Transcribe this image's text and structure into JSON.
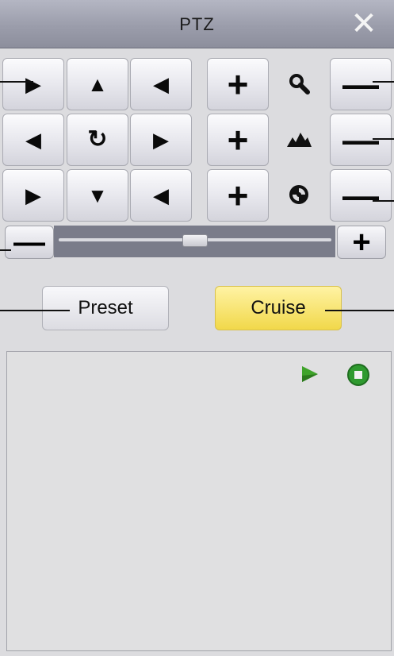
{
  "window": {
    "title": "PTZ",
    "close_symbol": "✕"
  },
  "direction_pad": [
    {
      "name": "up-left",
      "symbol": "▶"
    },
    {
      "name": "up",
      "symbol": "▲"
    },
    {
      "name": "up-right",
      "symbol": "◀"
    },
    {
      "name": "left",
      "symbol": "◀"
    },
    {
      "name": "auto-rotate",
      "symbol": "↻"
    },
    {
      "name": "right",
      "symbol": "▶"
    },
    {
      "name": "down-left",
      "symbol": "▶"
    },
    {
      "name": "down",
      "symbol": "▼"
    },
    {
      "name": "down-right",
      "symbol": "◀"
    }
  ],
  "controls": [
    {
      "name": "zoom",
      "icon": "magnifier-icon",
      "plus": "+",
      "minus": "—"
    },
    {
      "name": "focus",
      "icon": "mountain-icon",
      "plus": "+",
      "minus": "—"
    },
    {
      "name": "iris",
      "icon": "iris-icon",
      "plus": "+",
      "minus": "—"
    }
  ],
  "speed_slider": {
    "minus": "—",
    "plus": "+",
    "value_fraction": 0.5
  },
  "tabs": {
    "preset_label": "Preset",
    "cruise_label": "Cruise",
    "active": "Cruise"
  },
  "cruise_list": {
    "play_icon": "play-icon",
    "stop_icon": "stop-icon",
    "items": []
  },
  "colors": {
    "titlebar": "#9b9dab",
    "active_tab": "#f1d84a",
    "play_green": "#3fa32a",
    "stop_green": "#2f9a2f"
  }
}
